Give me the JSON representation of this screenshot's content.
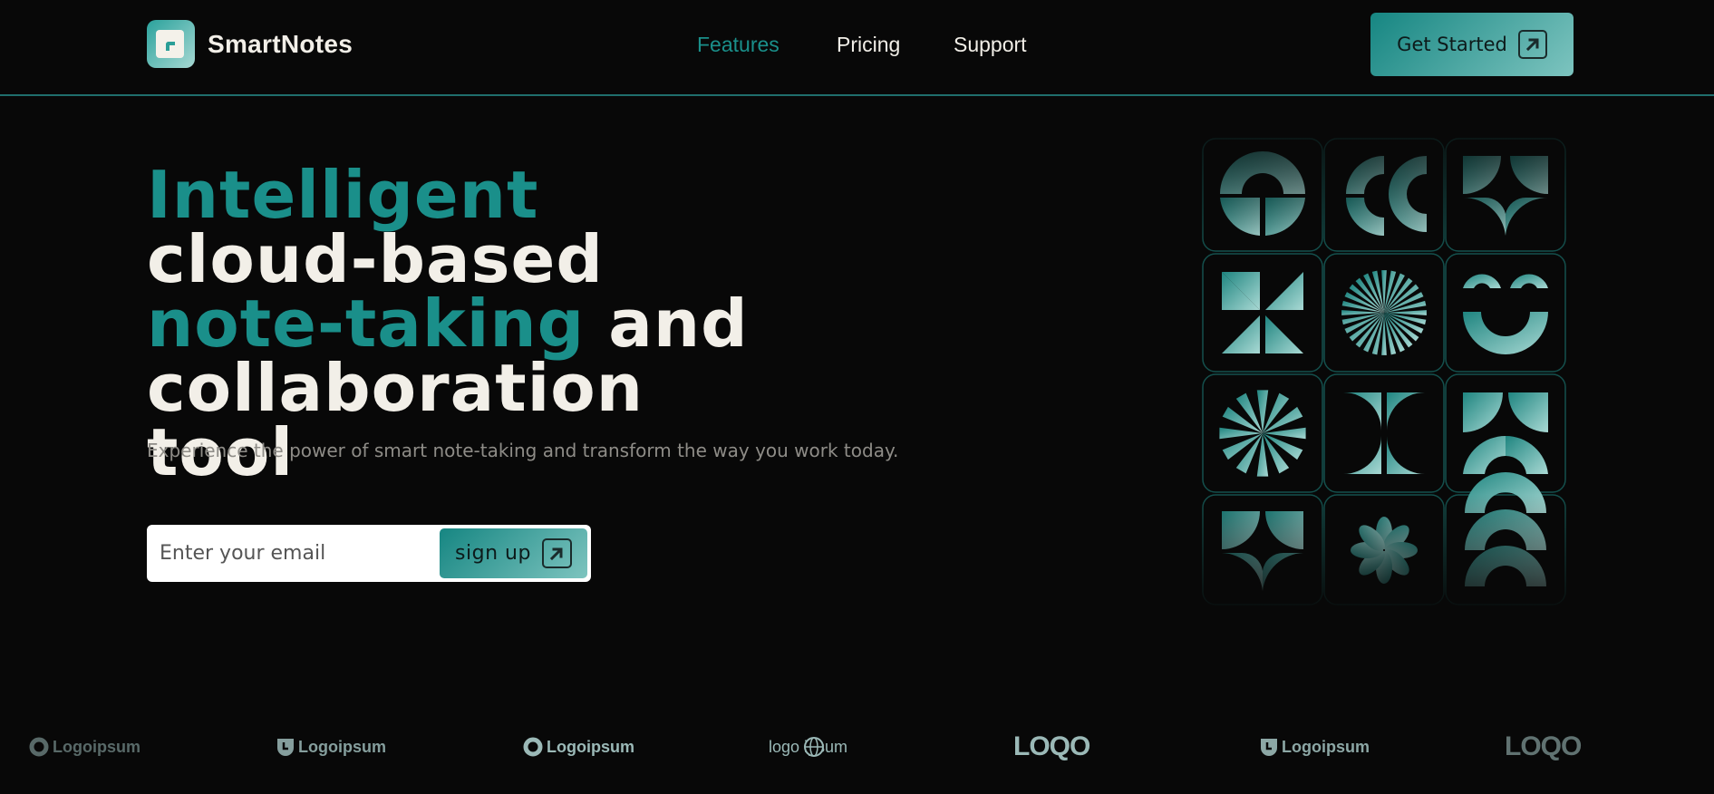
{
  "brand": {
    "name": "SmartNotes",
    "icon": "note-icon"
  },
  "nav": [
    {
      "label": "Features",
      "active": true
    },
    {
      "label": "Pricing",
      "active": false
    },
    {
      "label": "Support",
      "active": false
    }
  ],
  "cta": {
    "label": "Get Started",
    "icon": "arrow-up-right-icon"
  },
  "hero": {
    "title_part1": "Intelligent",
    "title_part2": " cloud-based",
    "title_part3": "note-taking",
    "title_part4": " and collaboration tool",
    "subtitle": "Experience the power of smart note-taking and transform the way you work today."
  },
  "signup": {
    "placeholder": "Enter your email",
    "value": "",
    "button_label": "sign up",
    "button_icon": "arrow-up-right-icon"
  },
  "logos": [
    {
      "text": "Logoipsum",
      "icon": "ring-logo-icon",
      "opacity": 0.55
    },
    {
      "text": "Logoipsum",
      "icon": "shield-logo-icon",
      "opacity": 0.85
    },
    {
      "text": "Logoipsum",
      "icon": "ring-logo-icon",
      "opacity": 1.0
    },
    {
      "text": "logo ipsum",
      "icon": "globe-logo-icon",
      "opacity": 1.0
    },
    {
      "text": "LOQO",
      "icon": "",
      "opacity": 1.0
    },
    {
      "text": "Logoipsum",
      "icon": "shield-logo-icon",
      "opacity": 0.9
    },
    {
      "text": "LOQO",
      "icon": "",
      "opacity": 0.6
    }
  ],
  "colors": {
    "accent": "#1a8f8a",
    "background": "#080808",
    "text": "#f2efe8",
    "muted": "#8e8c87"
  }
}
